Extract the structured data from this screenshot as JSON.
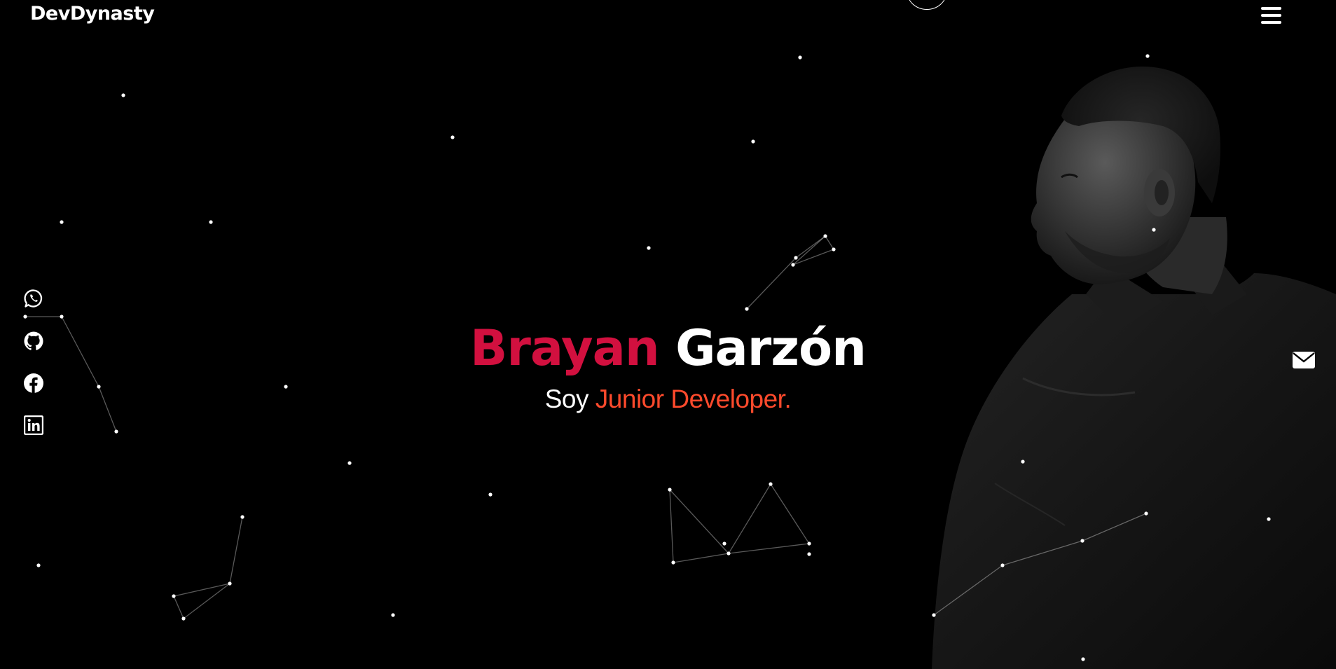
{
  "navbar": {
    "brand": "DevDynasty",
    "menu_icon": "hamburger-menu-icon"
  },
  "social_links": [
    {
      "name": "whatsapp",
      "icon": "whatsapp-icon"
    },
    {
      "name": "github",
      "icon": "github-icon"
    },
    {
      "name": "facebook",
      "icon": "facebook-icon"
    },
    {
      "name": "linkedin",
      "icon": "linkedin-icon"
    }
  ],
  "contact": {
    "icon": "envelope-icon"
  },
  "hero": {
    "first_name": "Brayan",
    "last_name": "Garzón",
    "intro": "Soy",
    "role": "Junior Developer."
  },
  "colors": {
    "background": "#000000",
    "accent_name": "#d2103f",
    "accent_role": "#ff4a2c",
    "text": "#ffffff"
  }
}
